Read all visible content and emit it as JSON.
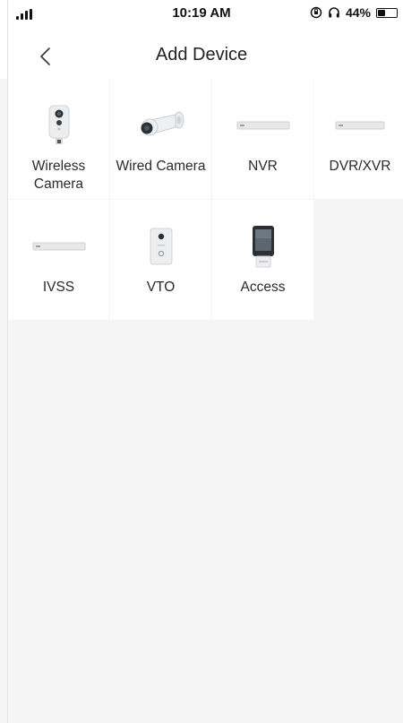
{
  "status_bar": {
    "time": "10:19 AM",
    "battery_percent": "44%",
    "battery_level": 0.44,
    "icons": [
      "signal-icon",
      "orientation-lock-icon",
      "headphones-icon",
      "battery-icon"
    ]
  },
  "nav": {
    "back_icon": "chevron-left-icon",
    "title": "Add Device"
  },
  "devices": [
    {
      "label": "Wireless Camera",
      "icon": "wireless-camera-icon"
    },
    {
      "label": "Wired Camera",
      "icon": "bullet-camera-icon"
    },
    {
      "label": "NVR",
      "icon": "nvr-recorder-icon"
    },
    {
      "label": "DVR/XVR",
      "icon": "dvr-recorder-icon"
    },
    {
      "label": "IVSS",
      "icon": "ivss-recorder-icon"
    },
    {
      "label": "VTO",
      "icon": "door-station-icon"
    },
    {
      "label": "Access",
      "icon": "access-control-icon"
    }
  ],
  "colors": {
    "background": "#f5f5f5",
    "surface": "#ffffff",
    "text": "#222222"
  }
}
